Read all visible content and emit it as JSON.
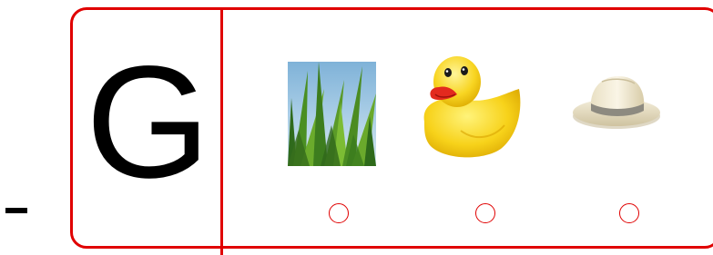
{
  "letter": "G",
  "options": [
    {
      "picture": "grass-picture",
      "selected": false
    },
    {
      "picture": "rubber-duck-picture",
      "selected": false
    },
    {
      "picture": "straw-hat-picture",
      "selected": false
    }
  ],
  "colors": {
    "frame": "#e00000",
    "radio": "#e00000",
    "text": "#000000"
  }
}
